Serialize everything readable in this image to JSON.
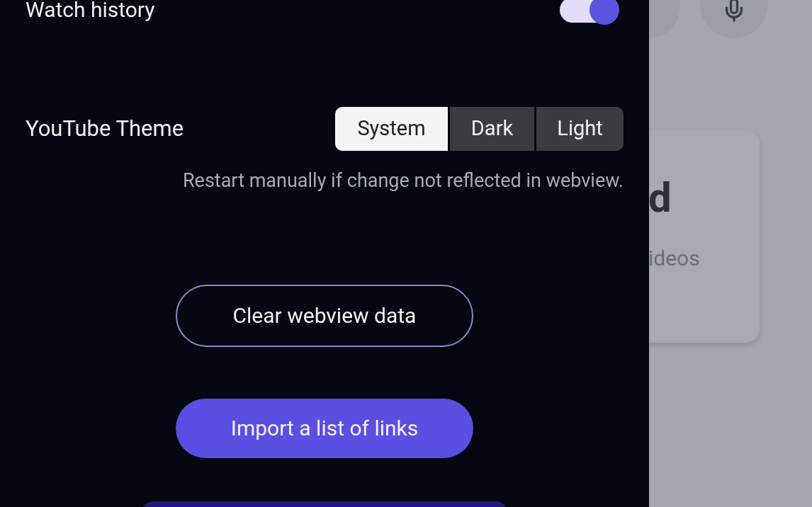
{
  "drawer": {
    "watch_history": {
      "label": "Watch history",
      "on": true
    },
    "theme": {
      "label": "YouTube Theme",
      "options": [
        {
          "label": "System",
          "selected": true
        },
        {
          "label": "Dark",
          "selected": false
        },
        {
          "label": "Light",
          "selected": false
        }
      ],
      "hint": "Restart manually if change not reflected in webview."
    },
    "buttons": [
      {
        "label": "Clear webview data",
        "kind": "outline"
      },
      {
        "label": "Import a list of links",
        "kind": "filled"
      }
    ]
  },
  "background": {
    "card_title": "d",
    "card_text": "ideos"
  }
}
